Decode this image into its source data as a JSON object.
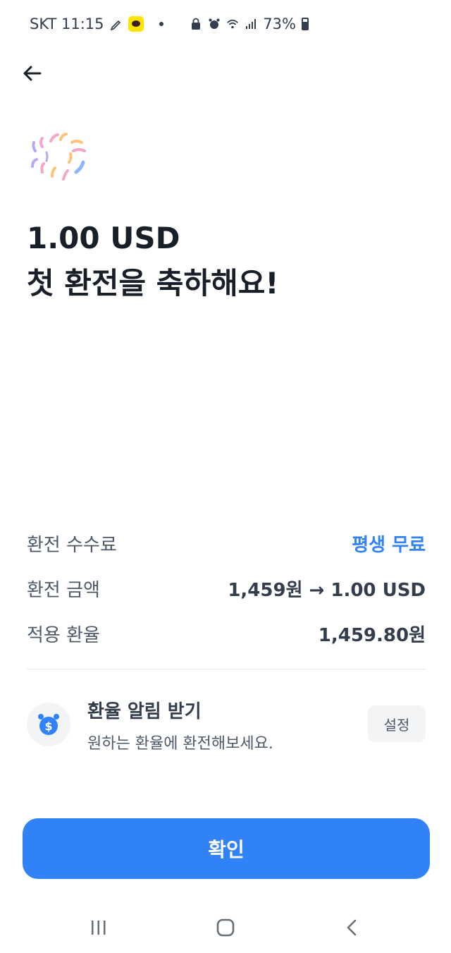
{
  "status_bar": {
    "carrier_time": "SKT 11:15",
    "battery": "73%"
  },
  "header": {
    "back_icon": "arrow-left-icon"
  },
  "hero": {
    "icon": "fireworks-icon",
    "amount": "1.00 USD",
    "message": "첫 환전을 축하해요!"
  },
  "details": [
    {
      "label": "환전 수수료",
      "value": "평생 무료"
    },
    {
      "label": "환전 금액",
      "value": "1,459원 → 1.00 USD"
    },
    {
      "label": "적용 환율",
      "value": "1,459.80원"
    }
  ],
  "alert": {
    "icon": "alarm-clock-dollar-icon",
    "title": "환율 알림 받기",
    "description": "원하는 환율에 환전해보세요.",
    "settings_label": "설정"
  },
  "confirm_label": "확인",
  "colors": {
    "accent": "#3182f6",
    "text_primary": "#191f28",
    "text_secondary": "#4e5968"
  }
}
